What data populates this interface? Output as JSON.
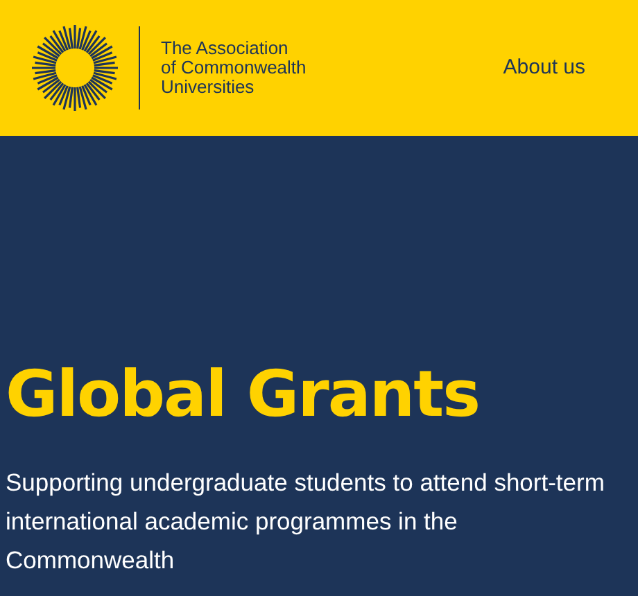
{
  "header": {
    "logo_text": [
      "The Association",
      "of Commonwealth",
      "Universities"
    ],
    "nav_link": "About us"
  },
  "hero": {
    "title": "Global Grants",
    "subtitle": "Supporting undergraduate students to attend short-term international academic programmes in the Commonwealth"
  }
}
